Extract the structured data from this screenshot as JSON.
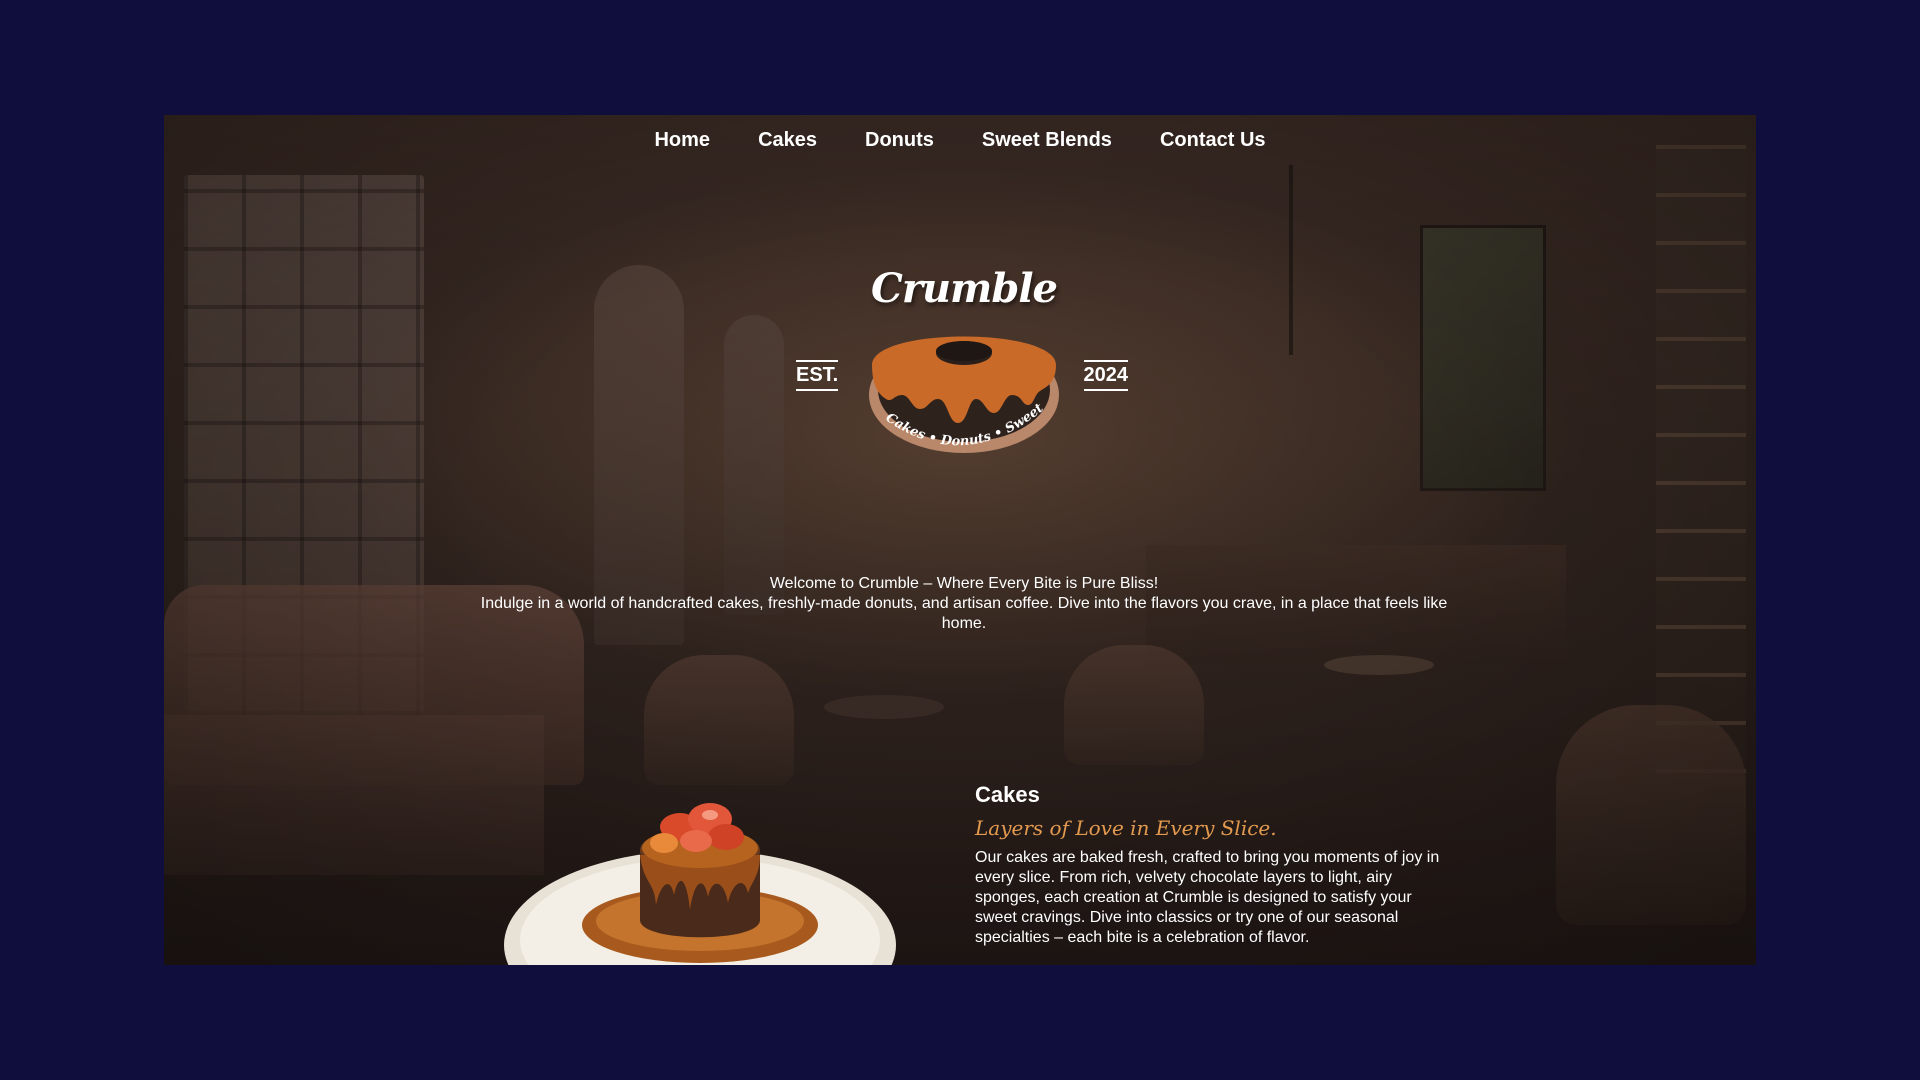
{
  "nav": {
    "items": [
      {
        "label": "Home"
      },
      {
        "label": "Cakes"
      },
      {
        "label": "Donuts"
      },
      {
        "label": "Sweet Blends"
      },
      {
        "label": "Contact Us"
      }
    ]
  },
  "logo": {
    "name": "Crumble",
    "est_label": "EST.",
    "year": "2024",
    "tagline": "Cakes • Donuts • Sweet Blends"
  },
  "intro": {
    "headline": "Welcome to Crumble – Where Every Bite is Pure Bliss!",
    "body": "Indulge in a world of handcrafted cakes, freshly-made donuts, and artisan coffee. Dive into the flavors you crave, in a place that feels like home."
  },
  "cakes_section": {
    "title": "Cakes",
    "tagline": "Layers of Love in Every Slice.",
    "body": "Our cakes are baked fresh, crafted to bring you moments of joy in every slice. From rich, velvety chocolate layers to light, airy sponges, each creation at Crumble is designed to satisfy your sweet cravings. Dive into classics or try one of our seasonal specialties – each bite is a celebration of flavor."
  },
  "colors": {
    "page_background": "#100e3c",
    "donut_glaze": "#c96a28",
    "donut_base": "#b9876a",
    "accent_tagline": "#e39a4f",
    "text": "#ffffff"
  },
  "icons": {
    "logo": "donut-logo-icon",
    "hero_image": "chocolate-cake-image"
  }
}
